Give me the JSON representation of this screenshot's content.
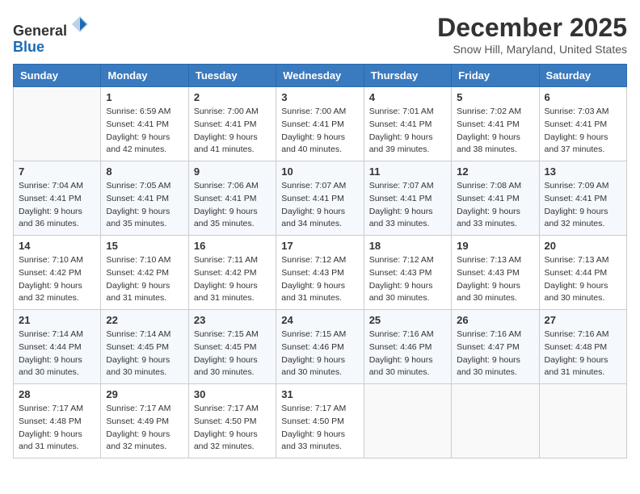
{
  "header": {
    "logo_line1": "General",
    "logo_line2": "Blue",
    "month": "December 2025",
    "location": "Snow Hill, Maryland, United States"
  },
  "weekdays": [
    "Sunday",
    "Monday",
    "Tuesday",
    "Wednesday",
    "Thursday",
    "Friday",
    "Saturday"
  ],
  "weeks": [
    [
      {
        "day": "",
        "info": ""
      },
      {
        "day": "1",
        "info": "Sunrise: 6:59 AM\nSunset: 4:41 PM\nDaylight: 9 hours\nand 42 minutes."
      },
      {
        "day": "2",
        "info": "Sunrise: 7:00 AM\nSunset: 4:41 PM\nDaylight: 9 hours\nand 41 minutes."
      },
      {
        "day": "3",
        "info": "Sunrise: 7:00 AM\nSunset: 4:41 PM\nDaylight: 9 hours\nand 40 minutes."
      },
      {
        "day": "4",
        "info": "Sunrise: 7:01 AM\nSunset: 4:41 PM\nDaylight: 9 hours\nand 39 minutes."
      },
      {
        "day": "5",
        "info": "Sunrise: 7:02 AM\nSunset: 4:41 PM\nDaylight: 9 hours\nand 38 minutes."
      },
      {
        "day": "6",
        "info": "Sunrise: 7:03 AM\nSunset: 4:41 PM\nDaylight: 9 hours\nand 37 minutes."
      }
    ],
    [
      {
        "day": "7",
        "info": "Sunrise: 7:04 AM\nSunset: 4:41 PM\nDaylight: 9 hours\nand 36 minutes."
      },
      {
        "day": "8",
        "info": "Sunrise: 7:05 AM\nSunset: 4:41 PM\nDaylight: 9 hours\nand 35 minutes."
      },
      {
        "day": "9",
        "info": "Sunrise: 7:06 AM\nSunset: 4:41 PM\nDaylight: 9 hours\nand 35 minutes."
      },
      {
        "day": "10",
        "info": "Sunrise: 7:07 AM\nSunset: 4:41 PM\nDaylight: 9 hours\nand 34 minutes."
      },
      {
        "day": "11",
        "info": "Sunrise: 7:07 AM\nSunset: 4:41 PM\nDaylight: 9 hours\nand 33 minutes."
      },
      {
        "day": "12",
        "info": "Sunrise: 7:08 AM\nSunset: 4:41 PM\nDaylight: 9 hours\nand 33 minutes."
      },
      {
        "day": "13",
        "info": "Sunrise: 7:09 AM\nSunset: 4:41 PM\nDaylight: 9 hours\nand 32 minutes."
      }
    ],
    [
      {
        "day": "14",
        "info": "Sunrise: 7:10 AM\nSunset: 4:42 PM\nDaylight: 9 hours\nand 32 minutes."
      },
      {
        "day": "15",
        "info": "Sunrise: 7:10 AM\nSunset: 4:42 PM\nDaylight: 9 hours\nand 31 minutes."
      },
      {
        "day": "16",
        "info": "Sunrise: 7:11 AM\nSunset: 4:42 PM\nDaylight: 9 hours\nand 31 minutes."
      },
      {
        "day": "17",
        "info": "Sunrise: 7:12 AM\nSunset: 4:43 PM\nDaylight: 9 hours\nand 31 minutes."
      },
      {
        "day": "18",
        "info": "Sunrise: 7:12 AM\nSunset: 4:43 PM\nDaylight: 9 hours\nand 30 minutes."
      },
      {
        "day": "19",
        "info": "Sunrise: 7:13 AM\nSunset: 4:43 PM\nDaylight: 9 hours\nand 30 minutes."
      },
      {
        "day": "20",
        "info": "Sunrise: 7:13 AM\nSunset: 4:44 PM\nDaylight: 9 hours\nand 30 minutes."
      }
    ],
    [
      {
        "day": "21",
        "info": "Sunrise: 7:14 AM\nSunset: 4:44 PM\nDaylight: 9 hours\nand 30 minutes."
      },
      {
        "day": "22",
        "info": "Sunrise: 7:14 AM\nSunset: 4:45 PM\nDaylight: 9 hours\nand 30 minutes."
      },
      {
        "day": "23",
        "info": "Sunrise: 7:15 AM\nSunset: 4:45 PM\nDaylight: 9 hours\nand 30 minutes."
      },
      {
        "day": "24",
        "info": "Sunrise: 7:15 AM\nSunset: 4:46 PM\nDaylight: 9 hours\nand 30 minutes."
      },
      {
        "day": "25",
        "info": "Sunrise: 7:16 AM\nSunset: 4:46 PM\nDaylight: 9 hours\nand 30 minutes."
      },
      {
        "day": "26",
        "info": "Sunrise: 7:16 AM\nSunset: 4:47 PM\nDaylight: 9 hours\nand 30 minutes."
      },
      {
        "day": "27",
        "info": "Sunrise: 7:16 AM\nSunset: 4:48 PM\nDaylight: 9 hours\nand 31 minutes."
      }
    ],
    [
      {
        "day": "28",
        "info": "Sunrise: 7:17 AM\nSunset: 4:48 PM\nDaylight: 9 hours\nand 31 minutes."
      },
      {
        "day": "29",
        "info": "Sunrise: 7:17 AM\nSunset: 4:49 PM\nDaylight: 9 hours\nand 32 minutes."
      },
      {
        "day": "30",
        "info": "Sunrise: 7:17 AM\nSunset: 4:50 PM\nDaylight: 9 hours\nand 32 minutes."
      },
      {
        "day": "31",
        "info": "Sunrise: 7:17 AM\nSunset: 4:50 PM\nDaylight: 9 hours\nand 33 minutes."
      },
      {
        "day": "",
        "info": ""
      },
      {
        "day": "",
        "info": ""
      },
      {
        "day": "",
        "info": ""
      }
    ]
  ]
}
